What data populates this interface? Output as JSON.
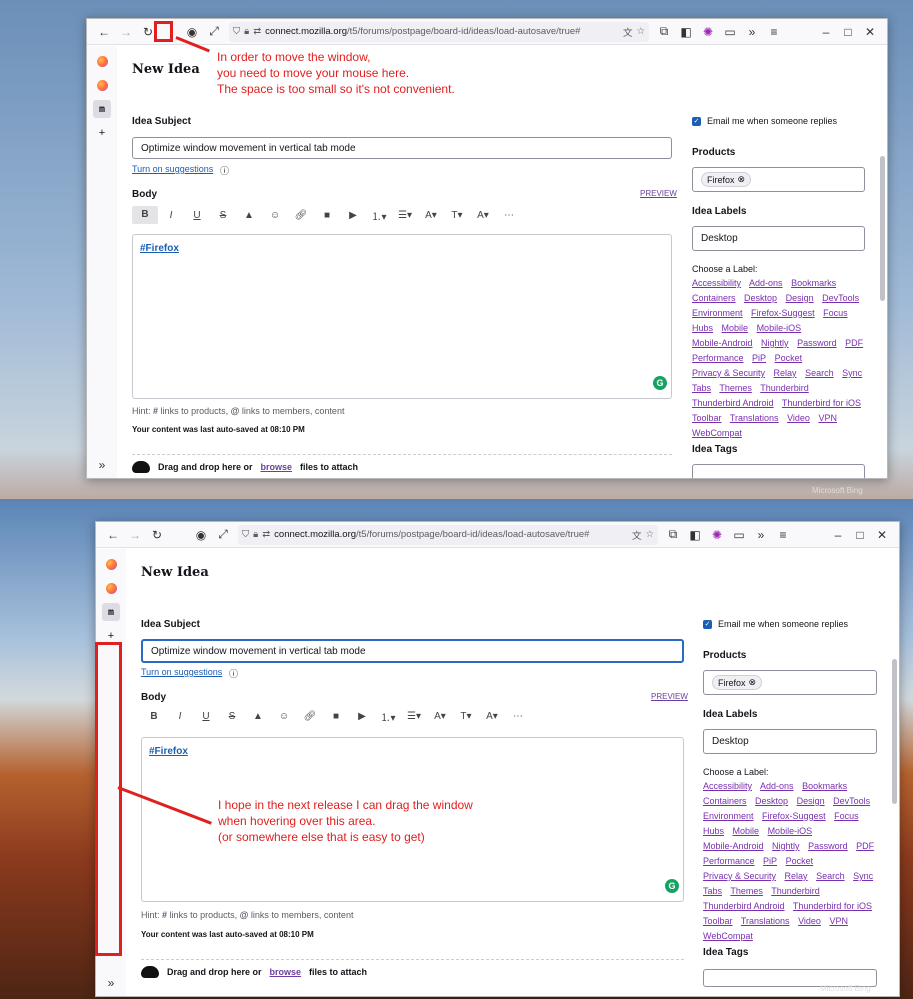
{
  "browser": {
    "url_domain": "connect.mozilla.org",
    "url_path": "/t5/forums/postpage/board-id/ideas/load-autosave/true#"
  },
  "page": {
    "title": "New Idea",
    "subject_label": "Idea Subject",
    "subject_value": "Optimize window movement in vertical tab mode",
    "suggestions_link": "Turn on suggestions",
    "body_label": "Body",
    "preview": "PREVIEW",
    "editor_content": "#Firefox",
    "hint_prefix": "Hint:",
    "hint_hash": "#",
    "hint_hash_text": "links to products,",
    "hint_at": "@",
    "hint_at_text": "links to members, content",
    "autosave": "Your content was last auto-saved at 08:10 PM",
    "drop_text1": "Drag and drop here or",
    "drop_browse": "browse",
    "drop_text2": "files to attach"
  },
  "right": {
    "email_label": "Email me when someone replies",
    "products_label": "Products",
    "product_chip": "Firefox",
    "idea_labels_label": "Idea Labels",
    "idea_labels_value": "Desktop",
    "choose_label": "Choose a Label:",
    "labels": [
      "Accessibility",
      "Add-ons",
      "Bookmarks",
      "Containers",
      "Desktop",
      "Design",
      "DevTools",
      "Environment",
      "Firefox-Suggest",
      "Focus",
      "Hubs",
      "Mobile",
      "Mobile-iOS",
      "Mobile-Android",
      "Nightly",
      "Password",
      "PDF",
      "Performance",
      "PiP",
      "Pocket",
      "Privacy & Security",
      "Relay",
      "Search",
      "Sync",
      "Tabs",
      "Themes",
      "Thunderbird",
      "Thunderbird Android",
      "Thunderbird for iOS",
      "Toolbar",
      "Translations",
      "Video",
      "VPN",
      "WebCompat"
    ],
    "idea_tags_label": "Idea Tags"
  },
  "annotations": {
    "top": [
      "In order to move the window,",
      "you need to move your mouse here.",
      "The space is too small so it's not convenient."
    ],
    "bottom": [
      "I hope in the next release I can drag the window",
      "when hovering over this area.",
      "(or somewhere else that is easy to get)"
    ]
  },
  "watermark": "Microsoft Bing"
}
